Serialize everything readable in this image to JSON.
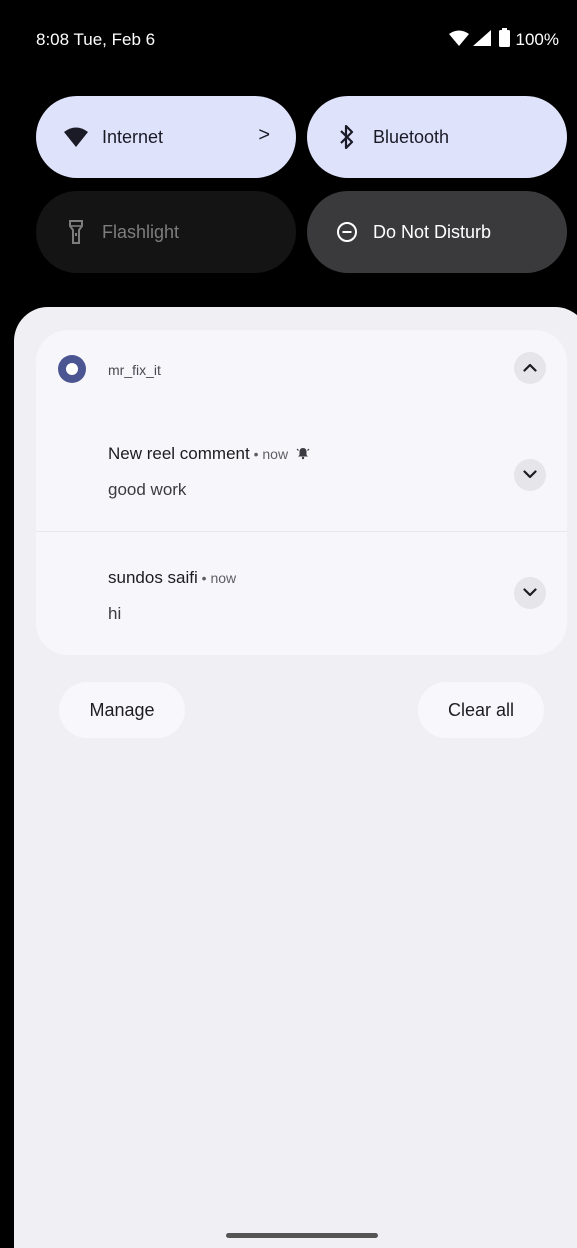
{
  "status_bar": {
    "time_date": "8:08 Tue, Feb 6",
    "battery": "100%",
    "wifi_icon": "wifi-icon",
    "signal_icon": "cell-signal-icon",
    "battery_icon": "battery-icon"
  },
  "quick_settings": {
    "tiles": [
      {
        "label": "Internet",
        "icon": "wifi-icon",
        "state": "on",
        "chevron": ">"
      },
      {
        "label": "Bluetooth",
        "icon": "bluetooth-icon",
        "state": "on"
      },
      {
        "label": "Flashlight",
        "icon": "flashlight-icon",
        "state": "unavailable"
      },
      {
        "label": "Do Not Disturb",
        "icon": "do-not-disturb-icon",
        "state": "off"
      }
    ]
  },
  "notification_group": {
    "app_name": "mr_fix_it",
    "notifications": [
      {
        "title": "New reel comment",
        "meta": " • now ",
        "text": "good work",
        "alert_icon": "alerted-bell-icon"
      },
      {
        "title": "sundos saifi",
        "meta": " • now",
        "text": "hi"
      }
    ]
  },
  "footer": {
    "manage_label": "Manage",
    "clear_all_label": "Clear all"
  },
  "colors": {
    "tile_active": "#dfe2fb",
    "tile_inactive": "#3a3a3c",
    "shade_bg": "#f0eff4",
    "app_icon": "#4a5591"
  }
}
